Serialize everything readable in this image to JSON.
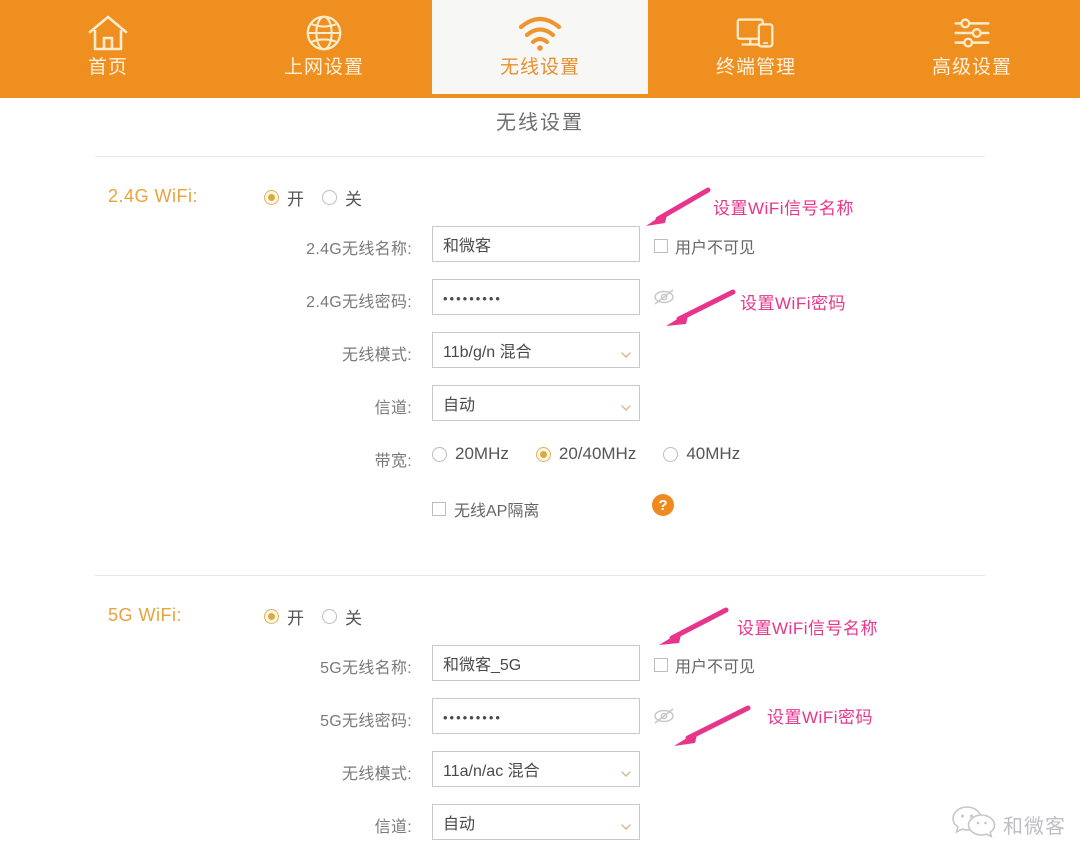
{
  "nav": {
    "items": [
      {
        "label": "首页",
        "icon": "home-icon",
        "active": false
      },
      {
        "label": "上网设置",
        "icon": "globe-icon",
        "active": false
      },
      {
        "label": "无线设置",
        "icon": "wifi-icon",
        "active": true
      },
      {
        "label": "终端管理",
        "icon": "devices-icon",
        "active": false
      },
      {
        "label": "高级设置",
        "icon": "sliders-icon",
        "active": false
      }
    ]
  },
  "page": {
    "title": "无线设置"
  },
  "sections": {
    "band24": {
      "band_label": "2.4G WiFi:",
      "toggle": {
        "on_label": "开",
        "off_label": "关",
        "selected": "on"
      },
      "ssid": {
        "label": "2.4G无线名称:",
        "value": "和微客",
        "hidden_checkbox_label": "用户不可见",
        "hidden_checked": false
      },
      "password": {
        "label": "2.4G无线密码:",
        "value": "•••••••••",
        "eye_icon": "eye-slash-icon"
      },
      "mode": {
        "label": "无线模式:",
        "value": "11b/g/n 混合"
      },
      "channel": {
        "label": "信道:",
        "value": "自动"
      },
      "bandwidth": {
        "label": "带宽:",
        "options": [
          "20MHz",
          "20/40MHz",
          "40MHz"
        ],
        "selected": "20/40MHz"
      },
      "ap_isolation": {
        "label": "无线AP隔离",
        "checked": false,
        "help_icon": "question-icon"
      }
    },
    "band5": {
      "band_label": "5G WiFi:",
      "toggle": {
        "on_label": "开",
        "off_label": "关",
        "selected": "on"
      },
      "ssid": {
        "label": "5G无线名称:",
        "value": "和微客_5G",
        "hidden_checkbox_label": "用户不可见",
        "hidden_checked": false
      },
      "password": {
        "label": "5G无线密码:",
        "value": "•••••••••",
        "eye_icon": "eye-slash-icon"
      },
      "mode": {
        "label": "无线模式:",
        "value": "11a/n/ac 混合"
      },
      "channel": {
        "label": "信道:",
        "value": "自动"
      }
    }
  },
  "annotations": {
    "a1": "设置WiFi信号名称",
    "a2": "设置WiFi密码",
    "a3": "设置WiFi信号名称",
    "a4": "设置WiFi密码"
  },
  "watermark": {
    "text": "和微客",
    "icon": "wechat-icon"
  },
  "colors": {
    "nav_orange": "#ef8f20",
    "active_tab_bg": "#f7f7f5",
    "band_label": "#e8a33c",
    "annotation_pink": "#e8358c",
    "radio_accent": "#e0a93c",
    "help_orange": "#f08a1e"
  }
}
